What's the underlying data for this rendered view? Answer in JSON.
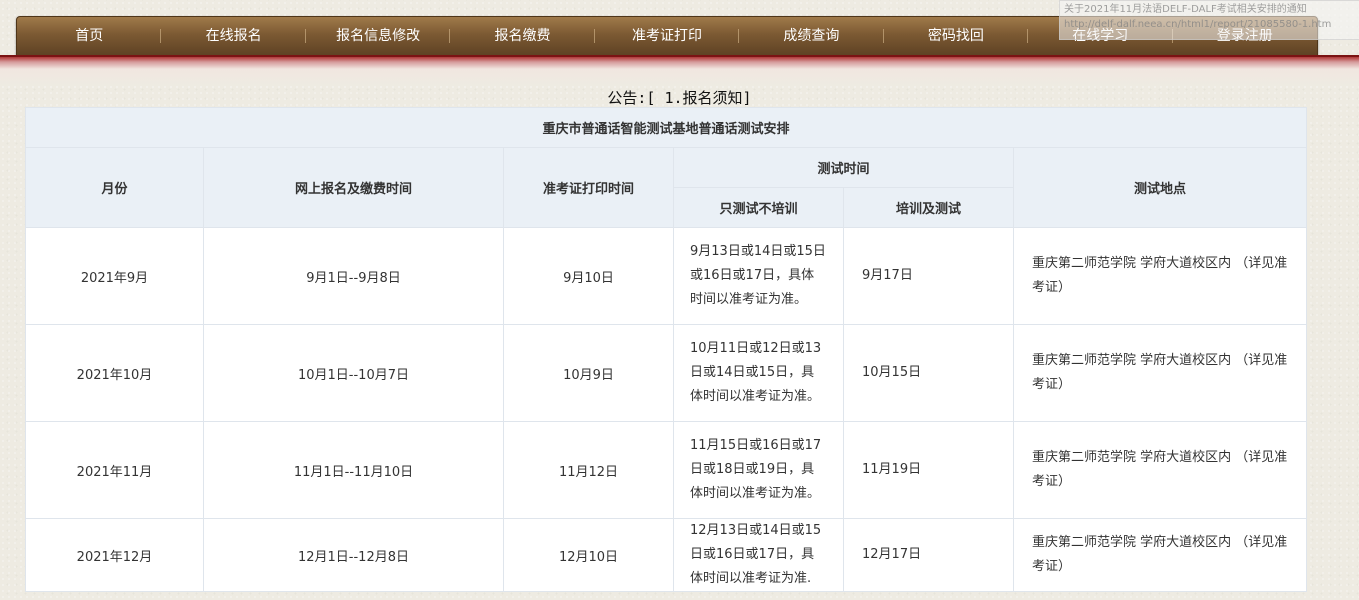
{
  "nav": {
    "items": [
      "首页",
      "在线报名",
      "报名信息修改",
      "报名缴费",
      "准考证打印",
      "成绩查询",
      "密码找回",
      "在线学习",
      "登录注册"
    ]
  },
  "tooltip": {
    "line1": "关于2021年11月法语DELF-DALF考试相关安排的通知",
    "line2": "http://delf-dalf.neea.cn/html1/report/21085580-1.htm"
  },
  "notice": "公告:[ 1.报名须知]",
  "table": {
    "title": "重庆市普通话智能测试基地普通话测试安排",
    "headers": {
      "month": "月份",
      "register": "网上报名及缴费时间",
      "ticket": "准考证打印时间",
      "test_time": "测试时间",
      "test_only": "只测试不培训",
      "train_test": "培训及测试",
      "location": "测试地点"
    },
    "rows": [
      {
        "month": "2021年9月",
        "register": "9月1日--9月8日",
        "ticket": "9月10日",
        "test_only": "9月13日或14日或15日或16日或17日，具体时间以准考证为准。",
        "train_test": "9月17日",
        "location": "重庆第二师范学院 学府大道校区内 （详见准考证）"
      },
      {
        "month": "2021年10月",
        "register": "10月1日--10月7日",
        "ticket": "10月9日",
        "test_only": "10月11日或12日或13日或14日或15日，具体时间以准考证为准。",
        "train_test": "10月15日",
        "location": "重庆第二师范学院 学府大道校区内 （详见准考证）"
      },
      {
        "month": "2021年11月",
        "register": "11月1日--11月10日",
        "ticket": "11月12日",
        "test_only": "11月15日或16日或17日或18日或19日，具体时间以准考证为准。",
        "train_test": "11月19日",
        "location": "重庆第二师范学院 学府大道校区内 （详见准考证）"
      },
      {
        "month": "2021年12月",
        "register": "12月1日--12月8日",
        "ticket": "12月10日",
        "test_only": "12月13日或14日或15日或16日或17日，具体时间以准考证为准.",
        "train_test": "12月17日",
        "location": "重庆第二师范学院 学府大道校区内 （详见准考证）"
      }
    ]
  },
  "colors": {
    "nav_brown": "#7c5a33",
    "accent_red": "#8c1e1e",
    "header_bg": "#eaf0f6",
    "page_bg": "#eeebe2"
  }
}
